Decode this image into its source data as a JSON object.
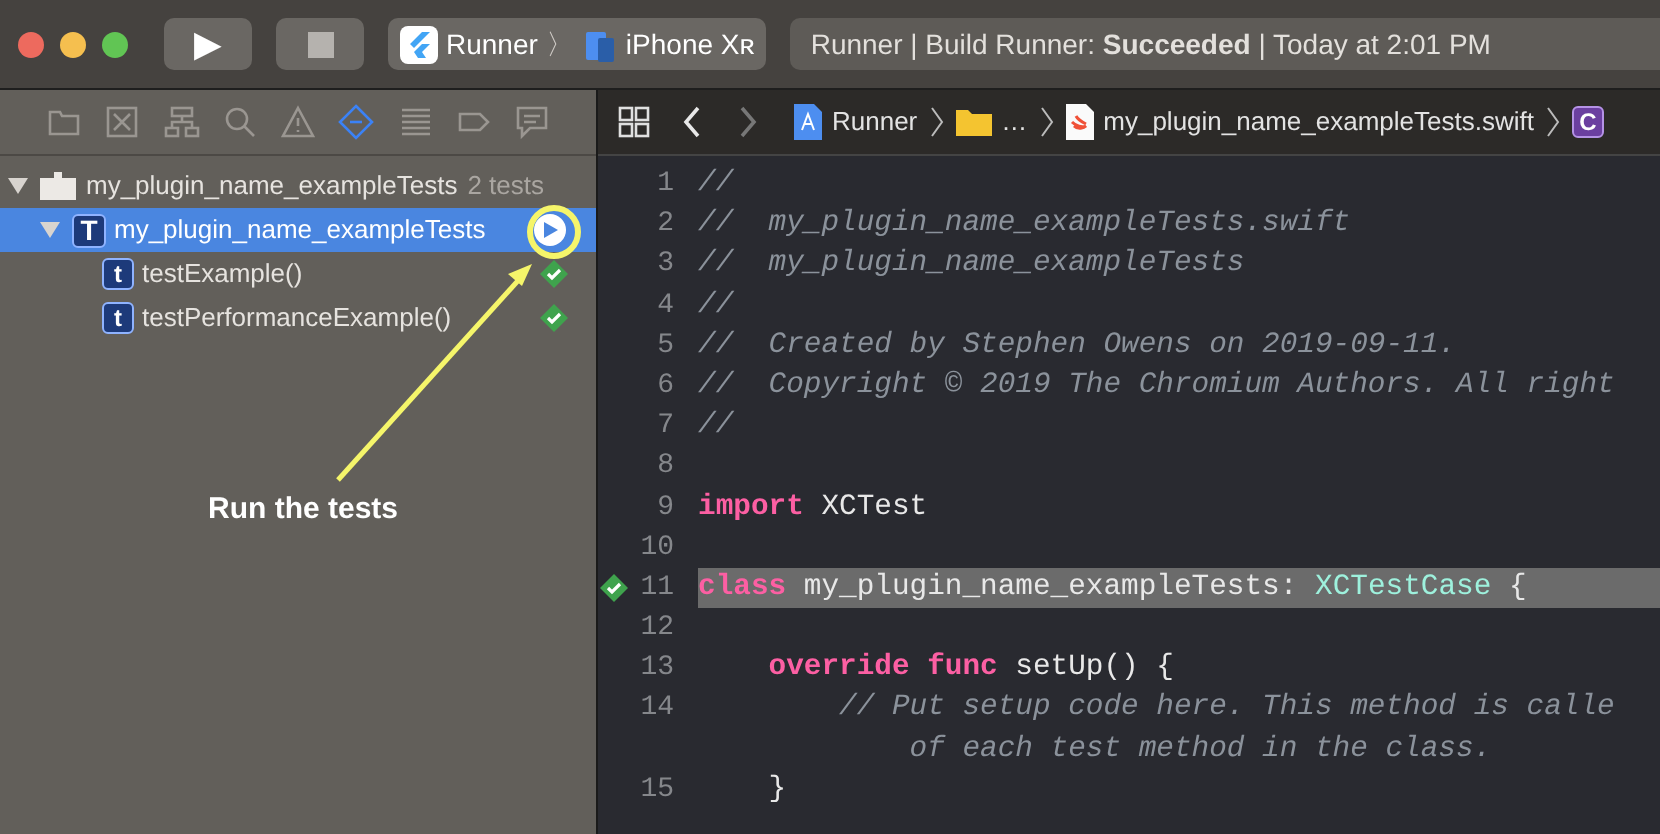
{
  "toolbar": {
    "run_button": {
      "symbol": "▶"
    },
    "scheme": {
      "project": "Runner",
      "separator": "〉",
      "device": "iPhone Xʀ"
    },
    "status": "Runner | Build Runner: **Succeeded** | Today at 2:01 PM"
  },
  "navigator": {
    "tabs": [
      {
        "kind": "folder",
        "selected": false
      },
      {
        "kind": "source-control",
        "selected": false
      },
      {
        "kind": "hierarchy",
        "selected": false
      },
      {
        "kind": "search",
        "selected": false
      },
      {
        "kind": "warning",
        "selected": false
      },
      {
        "kind": "test",
        "selected": true
      },
      {
        "kind": "debug",
        "selected": false
      },
      {
        "kind": "breakpoint",
        "selected": false
      },
      {
        "kind": "report",
        "selected": false
      }
    ],
    "tree": [
      {
        "name": "my_plugin_name_exampleTests",
        "count": "2 tests",
        "kind": "bundle",
        "expanded": true,
        "selected": false,
        "children": [
          {
            "name": "my_plugin_name_exampleTests",
            "badge": "T",
            "kind": "class",
            "expanded": true,
            "selected": true,
            "children": [
              {
                "name": "testExample()",
                "badge": "t",
                "kind": "method",
                "passed": true,
                "selected": false
              },
              {
                "name": "testPerformanceExample()",
                "badge": "t",
                "kind": "method",
                "passed": true,
                "selected": false
              }
            ]
          }
        ]
      }
    ]
  },
  "annotation": {
    "text": "Run the tests"
  },
  "editor": {
    "breadcrumbs": [
      {
        "kind": "project",
        "text": "Runner"
      },
      {
        "kind": "folder",
        "text": "…"
      },
      {
        "kind": "swift",
        "text": "my_plugin_name_exampleTests.swift"
      },
      {
        "kind": "class",
        "badge": "C"
      }
    ],
    "lines": [
      {
        "number": "1",
        "highlighted": false,
        "tokens": [
          {
            "kind": "comment",
            "text": "//"
          }
        ]
      },
      {
        "number": "2",
        "highlighted": false,
        "tokens": [
          {
            "kind": "comment",
            "text": "//  my_plugin_name_exampleTests.swift"
          }
        ]
      },
      {
        "number": "3",
        "highlighted": false,
        "tokens": [
          {
            "kind": "comment",
            "text": "//  my_plugin_name_exampleTests"
          }
        ]
      },
      {
        "number": "4",
        "highlighted": false,
        "tokens": [
          {
            "kind": "comment",
            "text": "//"
          }
        ]
      },
      {
        "number": "5",
        "highlighted": false,
        "tokens": [
          {
            "kind": "comment",
            "text": "//  Created by Stephen Owens on 2019-09-11."
          }
        ]
      },
      {
        "number": "6",
        "highlighted": false,
        "tokens": [
          {
            "kind": "comment",
            "text": "//  Copyright © 2019 The Chromium Authors. All right"
          }
        ]
      },
      {
        "number": "7",
        "highlighted": false,
        "tokens": [
          {
            "kind": "comment",
            "text": "//"
          }
        ]
      },
      {
        "number": "8",
        "highlighted": false
      },
      {
        "number": "9",
        "highlighted": false,
        "tokens": [
          {
            "kind": "keyword",
            "text": "import"
          },
          {
            "kind": "plain",
            "text": " XCTest"
          }
        ]
      },
      {
        "number": "10",
        "highlighted": false
      },
      {
        "number": "11",
        "highlighted": true,
        "test_passed": true,
        "tokens": [
          {
            "kind": "keyword",
            "text": "class"
          },
          {
            "kind": "plain",
            "text": " my_plugin_name_exampleTests: "
          },
          {
            "kind": "type",
            "text": "XCTestCase"
          },
          {
            "kind": "plain",
            "text": " {"
          }
        ]
      },
      {
        "number": "12",
        "highlighted": false
      },
      {
        "number": "13",
        "highlighted": false,
        "tokens": [
          {
            "kind": "keyword",
            "text": "    override func"
          },
          {
            "kind": "plain",
            "text": " setUp() {"
          }
        ]
      },
      {
        "number": "14",
        "highlighted": false,
        "tokens": [
          {
            "kind": "comment",
            "text": "        // Put setup code here. This method is calle"
          }
        ]
      },
      {
        "highlighted": false,
        "tokens": [
          {
            "kind": "comment",
            "text": "            of each test method in the class."
          }
        ]
      },
      {
        "number": "15",
        "highlighted": false,
        "tokens": [
          {
            "kind": "plain",
            "text": "    }"
          }
        ]
      }
    ]
  }
}
